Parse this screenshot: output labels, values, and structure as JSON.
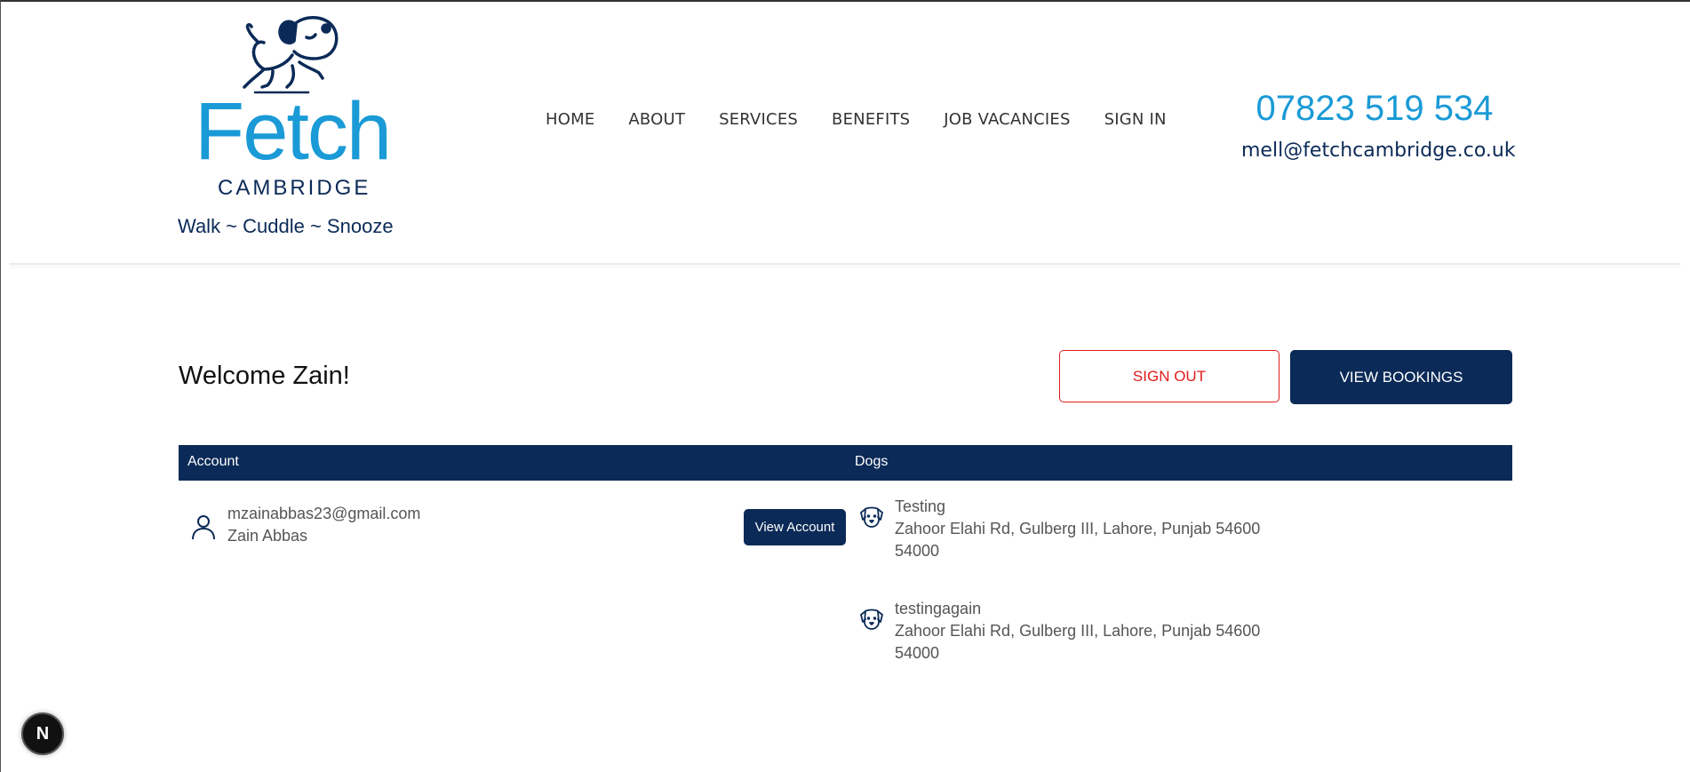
{
  "logo": {
    "brand": "Fetch",
    "city": "CAMBRIDGE",
    "tagline": "Walk ~ Cuddle ~ Snooze",
    "icon": "dog-logo-icon",
    "brand_color": "#1a9ad6",
    "navy_color": "#0b2a57"
  },
  "nav": {
    "items": [
      "HOME",
      "ABOUT",
      "SERVICES",
      "BENEFITS",
      "JOB VACANCIES",
      "SIGN IN"
    ]
  },
  "contact": {
    "phone": "07823 519 534",
    "email": "mell@fetchcambridge.co.uk"
  },
  "welcome": {
    "text": "Welcome Zain!",
    "sign_out_label": "SIGN OUT",
    "view_bookings_label": "VIEW BOOKINGS"
  },
  "table": {
    "headers": {
      "account": "Account",
      "dogs": "Dogs"
    },
    "account": {
      "email": "mzainabbas23@gmail.com",
      "name": "Zain Abbas",
      "icon": "user-icon",
      "view_account_label": "View Account"
    },
    "dogs": [
      {
        "name": "Testing",
        "address": "Zahoor Elahi Rd, Gulberg III, Lahore, Punjab 54600",
        "postcode": "54000",
        "icon": "dog-face-icon"
      },
      {
        "name": "testingagain",
        "address": "Zahoor Elahi Rd, Gulberg III, Lahore, Punjab 54600",
        "postcode": "54000",
        "icon": "dog-face-icon"
      }
    ]
  },
  "badge": {
    "letter": "N"
  },
  "colors": {
    "accent": "#0b2a57",
    "danger": "#e01b1b",
    "link_blue": "#1a9ad6"
  }
}
